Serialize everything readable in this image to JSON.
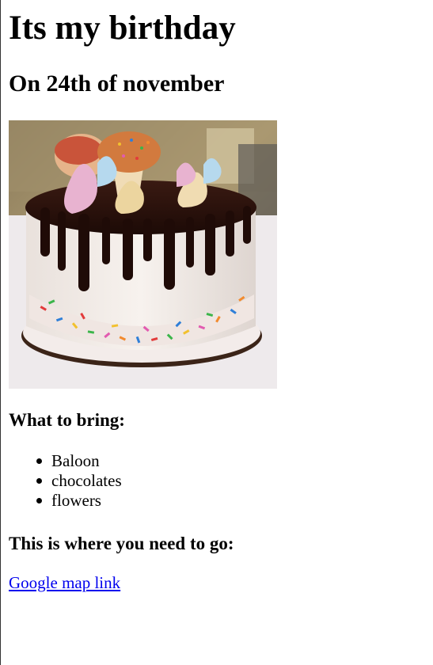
{
  "page": {
    "title": "Its my birthday",
    "subtitle": "On 24th of november",
    "image_alt": "birthday-cake"
  },
  "bring": {
    "heading": "What to bring:",
    "items": [
      "Baloon",
      "chocolates",
      "flowers"
    ]
  },
  "location": {
    "heading": "This is where you need to go:",
    "link_text": "Google map link"
  },
  "colors": {
    "link": "#0000ee",
    "text": "#000000",
    "background": "#ffffff"
  }
}
